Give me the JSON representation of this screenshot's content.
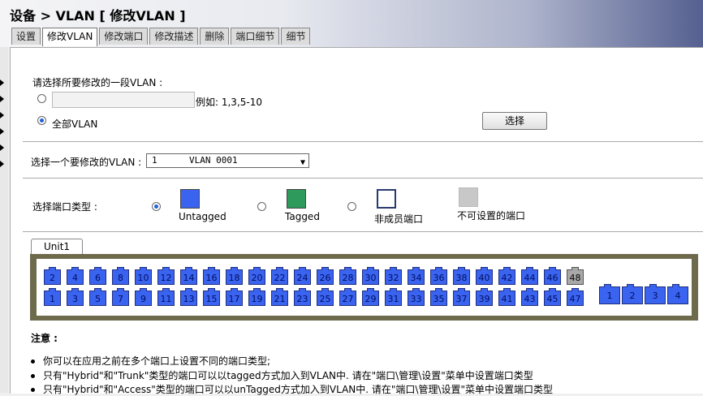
{
  "header": {
    "title": "设备 > VLAN [ 修改VLAN ]",
    "tabs": [
      "设置",
      "修改VLAN",
      "修改端口",
      "修改描述",
      "删除",
      "端口细节",
      "细节"
    ],
    "active_tab": "修改VLAN"
  },
  "vlan_range": {
    "prompt": "请选择所要修改的一段VLAN :",
    "input_value": "",
    "example": "例如: 1,3,5-10",
    "all_vlan_label": "全部VLAN",
    "all_vlan_selected": true,
    "select_button": "选择"
  },
  "vlan_select": {
    "label": "选择一个要修改的VLAN :",
    "selected_id": "1",
    "selected_name": "VLAN 0001"
  },
  "port_type": {
    "label": "选择端口类型 :",
    "options": [
      {
        "label": "Untagged",
        "color": "#3a63f0",
        "selected": true
      },
      {
        "label": "Tagged",
        "color": "#2e9a5c",
        "selected": false
      },
      {
        "label": "非成员端口",
        "color": "#ffffff",
        "selected": false
      },
      {
        "label": "不可设置的端口",
        "color": "#c8c8c8",
        "selected": null
      }
    ]
  },
  "unit": {
    "tab_label": "Unit1",
    "top_row": [
      "2",
      "4",
      "6",
      "8",
      "10",
      "12",
      "14",
      "16",
      "18",
      "20",
      "22",
      "24",
      "26",
      "28",
      "30",
      "32",
      "34",
      "36",
      "38",
      "40",
      "42",
      "44",
      "46",
      "48"
    ],
    "bottom_row": [
      "1",
      "3",
      "5",
      "7",
      "9",
      "11",
      "13",
      "15",
      "17",
      "19",
      "21",
      "23",
      "25",
      "27",
      "29",
      "31",
      "33",
      "35",
      "37",
      "39",
      "41",
      "43",
      "45",
      "47"
    ],
    "grey_ports": [
      "48"
    ],
    "uplink_ports": [
      "1",
      "2",
      "3",
      "4"
    ]
  },
  "notes": {
    "title": "注意 :",
    "items": [
      "你可以在应用之前在多个端口上设置不同的端口类型;",
      "只有\"Hybrid\"和\"Trunk\"类型的端口可以以tagged方式加入到VLAN中. 请在\"端口\\管理\\设置\"菜单中设置端口类型",
      "只有\"Hybrid\"和\"Access\"类型的端口可以以unTagged方式加入到VLAN中. 请在\"端口\\管理\\设置\"菜单中设置端口类型"
    ]
  }
}
